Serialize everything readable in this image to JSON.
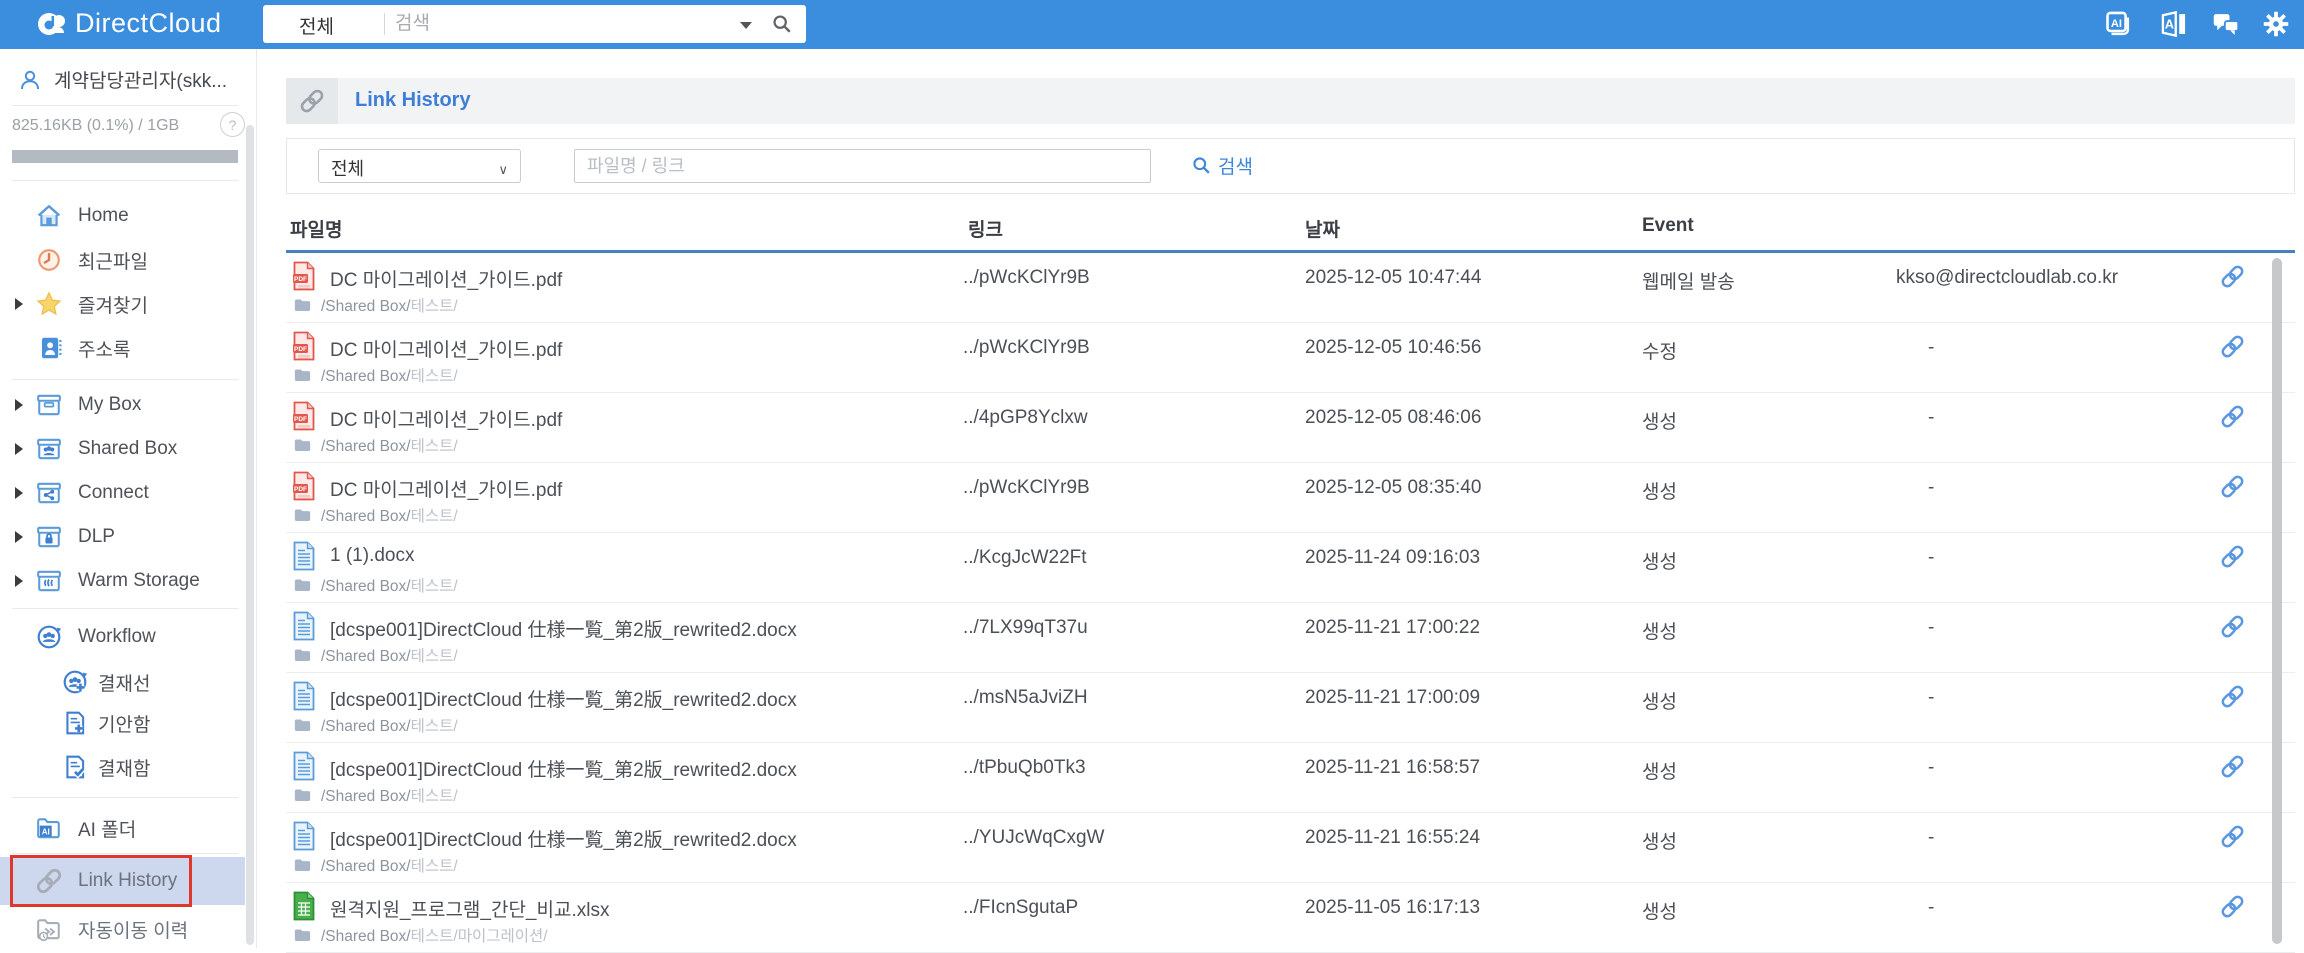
{
  "topbar": {
    "brand_bold": "Direct",
    "brand_light": "Cloud",
    "search_scope": "전체",
    "search_placeholder": "검색",
    "icons": [
      "ai-documents",
      "translate",
      "chat",
      "settings"
    ]
  },
  "sidebar": {
    "user_name": "계약담당관리자(skk...",
    "storage_usage": "825.16KB (0.1%) / 1GB",
    "help": "?",
    "items": [
      {
        "label": "Home"
      },
      {
        "label": "최근파일"
      },
      {
        "label": "즐겨찾기"
      },
      {
        "label": "주소록"
      },
      {
        "label": "My Box"
      },
      {
        "label": "Shared Box"
      },
      {
        "label": "Connect"
      },
      {
        "label": "DLP"
      },
      {
        "label": "Warm Storage"
      },
      {
        "label": "Workflow"
      },
      {
        "label": "결재선"
      },
      {
        "label": "기안함"
      },
      {
        "label": "결재함"
      },
      {
        "label": "AI 폴더"
      },
      {
        "label": "Link History",
        "selected": true
      },
      {
        "label": "자동이동 이력"
      }
    ]
  },
  "main": {
    "title": "Link History",
    "filter": {
      "scope_selected": "전체",
      "caret": "∨",
      "keyword_placeholder": "파일명 / 링크",
      "search_label": "검색"
    },
    "table": {
      "headers": {
        "file": "파일명",
        "link": "링크",
        "date": "날짜",
        "event": "Event"
      },
      "rows": [
        {
          "file": "DC 마이그레이션_가이드.pdf",
          "type": "pdf",
          "path_root": "/Shared Box/",
          "path_rest": "테스트/",
          "link": "../pWcKClYr9B",
          "date": "2025-12-05 10:47:44",
          "event": "웹메일 발송",
          "target": "kkso@directcloudlab.co.kr"
        },
        {
          "file": "DC 마이그레이션_가이드.pdf",
          "type": "pdf",
          "path_root": "/Shared Box/",
          "path_rest": "테스트/",
          "link": "../pWcKClYr9B",
          "date": "2025-12-05 10:46:56",
          "event": "수정",
          "target": "-"
        },
        {
          "file": "DC 마이그레이션_가이드.pdf",
          "type": "pdf",
          "path_root": "/Shared Box/",
          "path_rest": "테스트/",
          "link": "../4pGP8Yclxw",
          "date": "2025-12-05 08:46:06",
          "event": "생성",
          "target": "-"
        },
        {
          "file": "DC 마이그레이션_가이드.pdf",
          "type": "pdf",
          "path_root": "/Shared Box/",
          "path_rest": "테스트/",
          "link": "../pWcKClYr9B",
          "date": "2025-12-05 08:35:40",
          "event": "생성",
          "target": "-"
        },
        {
          "file": "1 (1).docx",
          "type": "docx",
          "path_root": "/Shared Box/",
          "path_rest": "테스트/",
          "link": "../KcgJcW22Ft",
          "date": "2025-11-24 09:16:03",
          "event": "생성",
          "target": "-"
        },
        {
          "file": "[dcspe001]DirectCloud 仕様一覧_第2版_rewrited2.docx",
          "type": "docx",
          "path_root": "/Shared Box/",
          "path_rest": "테스트/",
          "link": "../7LX99qT37u",
          "date": "2025-11-21 17:00:22",
          "event": "생성",
          "target": "-"
        },
        {
          "file": "[dcspe001]DirectCloud 仕様一覧_第2版_rewrited2.docx",
          "type": "docx",
          "path_root": "/Shared Box/",
          "path_rest": "테스트/",
          "link": "../msN5aJviZH",
          "date": "2025-11-21 17:00:09",
          "event": "생성",
          "target": "-"
        },
        {
          "file": "[dcspe001]DirectCloud 仕様一覧_第2版_rewrited2.docx",
          "type": "docx",
          "path_root": "/Shared Box/",
          "path_rest": "테스트/",
          "link": "../tPbuQb0Tk3",
          "date": "2025-11-21 16:58:57",
          "event": "생성",
          "target": "-"
        },
        {
          "file": "[dcspe001]DirectCloud 仕様一覧_第2版_rewrited2.docx",
          "type": "docx",
          "path_root": "/Shared Box/",
          "path_rest": "테스트/",
          "link": "../YUJcWqCxgW",
          "date": "2025-11-21 16:55:24",
          "event": "생성",
          "target": "-"
        },
        {
          "file": "원격지원_프로그램_간단_비교.xlsx",
          "type": "xlsx",
          "path_root": "/Shared Box/",
          "path_rest": "테스트/마이그레이션/",
          "link": "../FIcnSgutaP",
          "date": "2025-11-05 16:17:13",
          "event": "생성",
          "target": "-"
        }
      ]
    }
  },
  "colors": {
    "topbar_blue": "#3b8ddd",
    "accent_blue": "#3e86dc",
    "title_blue": "#3e7ed6",
    "header_underline": "#4781c2",
    "selected_item_bg": "#cdd7ee",
    "annotation_red": "#df362d",
    "pdf_red": "#e2574c",
    "docx_blue": "#5b9bd8",
    "xlsx_green": "#47b04b",
    "chain_blue": "#5a97e0"
  }
}
